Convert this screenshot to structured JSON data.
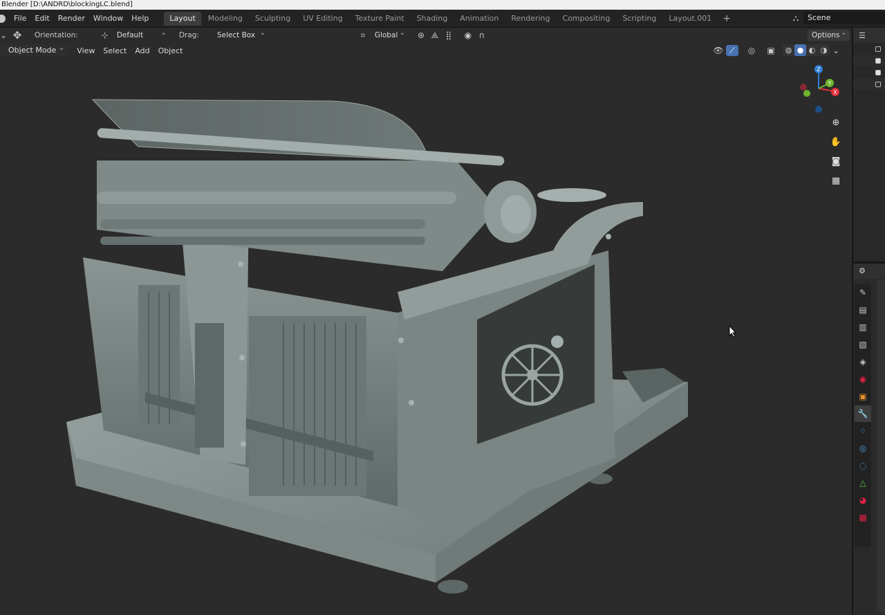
{
  "window": {
    "title": "Blender [D:\\ANDRD\\blockingLC.blend]"
  },
  "menu": {
    "items": [
      "File",
      "Edit",
      "Render",
      "Window",
      "Help"
    ]
  },
  "workspaces": {
    "tabs": [
      "Layout",
      "Modeling",
      "Sculpting",
      "UV Editing",
      "Texture Paint",
      "Shading",
      "Animation",
      "Rendering",
      "Compositing",
      "Scripting",
      "Layout.001"
    ],
    "active": "Layout",
    "add_label": "+"
  },
  "scene": {
    "name": "Scene"
  },
  "tool_settings": {
    "orientation_label": "Orientation:",
    "orientation_value": "Default",
    "drag_label": "Drag:",
    "drag_value": "Select Box",
    "transform_orientation": "Global",
    "options_label": "Options"
  },
  "viewport_header": {
    "mode": "Object Mode",
    "menus": [
      "View",
      "Select",
      "Add",
      "Object"
    ]
  },
  "gizmo": {
    "z": "Z",
    "y": "Y",
    "x": "X"
  },
  "colors": {
    "accent": "#4772b3",
    "x_axis": "#e0303d",
    "y_axis": "#6db52d",
    "z_axis": "#2e7fd6",
    "model": "#8f9a98"
  },
  "icons": {
    "nav": [
      "zoom-icon",
      "hand-pan-icon",
      "camera-icon",
      "grid-ortho-icon"
    ],
    "properties_tabs": [
      "tool-icon",
      "render-icon",
      "output-icon",
      "view-layer-icon",
      "scene-icon",
      "world-icon",
      "object-icon",
      "modifier-icon",
      "particles-icon",
      "physics-icon",
      "constraints-icon",
      "data-icon",
      "material-icon",
      "texture-icon"
    ]
  }
}
